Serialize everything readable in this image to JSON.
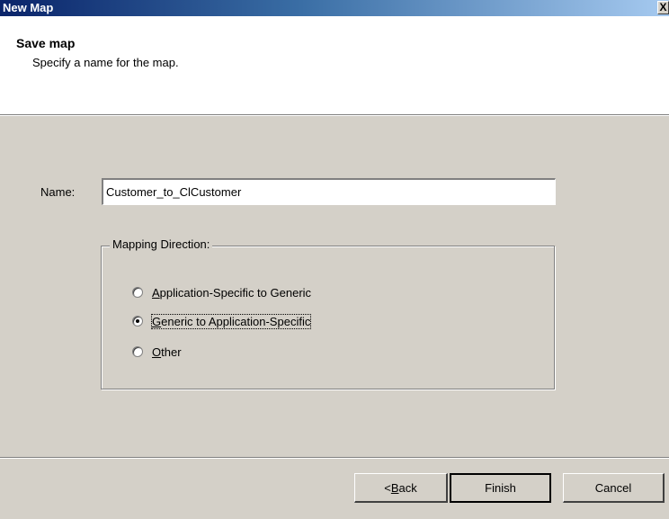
{
  "window": {
    "title": "New Map",
    "close_glyph": "X"
  },
  "header": {
    "title": "Save map",
    "subtitle": "Specify a name for the map."
  },
  "name": {
    "label": "Name:",
    "value": "Customer_to_ClCustomer"
  },
  "mapping": {
    "legend": "Mapping Direction:",
    "options": [
      {
        "accel": "A",
        "rest": "pplication-Specific to Generic",
        "checked": false
      },
      {
        "accel": "G",
        "rest": "eneric to Application-Specific",
        "checked": true
      },
      {
        "accel": "O",
        "rest": "ther",
        "checked": false
      }
    ]
  },
  "buttons": {
    "back_prefix": "< ",
    "back_accel": "B",
    "back_rest": "ack",
    "finish": "Finish",
    "cancel": "Cancel"
  }
}
